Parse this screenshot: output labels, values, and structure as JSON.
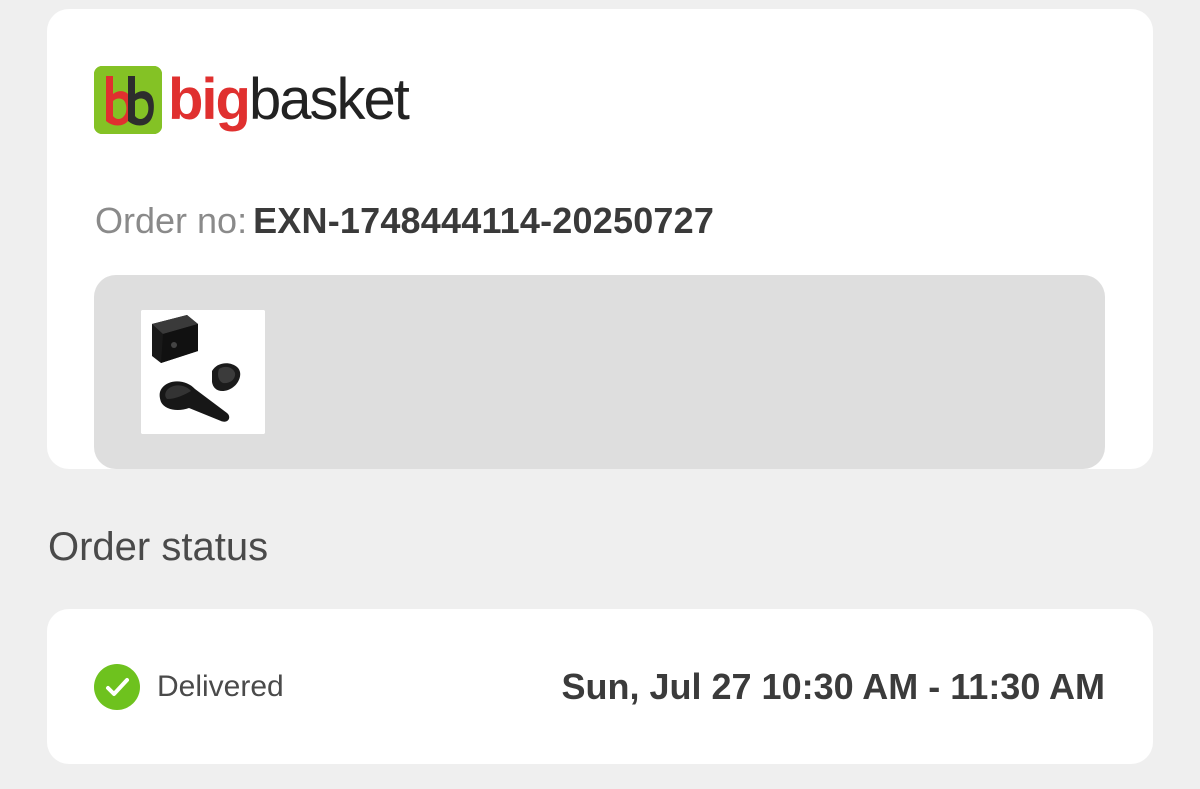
{
  "brand": {
    "logo_word_primary": "big",
    "logo_word_secondary": "basket",
    "logo_name": "bigbasket",
    "accent_green": "#84c225",
    "accent_red": "#e0302f"
  },
  "order": {
    "label": "Order no:",
    "number": "EXN-1748444114-20250727"
  },
  "items": [
    {
      "image_icon": "earbuds-product-image"
    }
  ],
  "status_section": {
    "title": "Order status",
    "status": "Delivered",
    "status_icon": "check-circle-icon",
    "status_color": "#6ec21e",
    "delivery_window": "Sun, Jul 27 10:30 AM - 11:30 AM"
  }
}
